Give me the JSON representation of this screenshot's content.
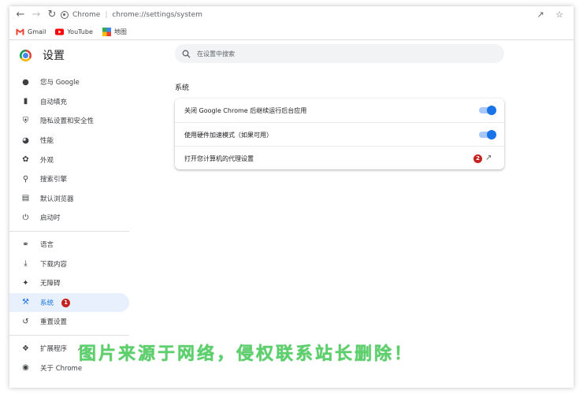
{
  "toolbar": {
    "back_icon": "arrow-left-icon",
    "forward_icon": "arrow-right-icon",
    "reload_icon": "reload-icon",
    "site_name": "Chrome",
    "url": "chrome://settings/system",
    "share_icon": "share-icon",
    "bookmark_icon": "star-icon"
  },
  "bookmarks": [
    {
      "label": "Gmail",
      "icon": "gmail-icon"
    },
    {
      "label": "YouTube",
      "icon": "youtube-icon"
    },
    {
      "label": "地图",
      "icon": "maps-icon"
    }
  ],
  "sidebar": {
    "title": "设置",
    "items_group1": [
      {
        "label": "您与 Google",
        "icon": "person-icon"
      },
      {
        "label": "自动填充",
        "icon": "clipboard-icon"
      },
      {
        "label": "隐私设置和安全性",
        "icon": "shield-icon"
      },
      {
        "label": "性能",
        "icon": "speedometer-icon"
      },
      {
        "label": "外观",
        "icon": "palette-icon"
      },
      {
        "label": "搜索引擎",
        "icon": "search-icon"
      },
      {
        "label": "默认浏览器",
        "icon": "browser-icon"
      },
      {
        "label": "启动时",
        "icon": "power-icon"
      }
    ],
    "items_group2": [
      {
        "label": "语言",
        "icon": "globe-icon"
      },
      {
        "label": "下载内容",
        "icon": "download-icon"
      },
      {
        "label": "无障碍",
        "icon": "accessibility-icon"
      },
      {
        "label": "系统",
        "icon": "wrench-icon",
        "active": true,
        "badge": "1"
      },
      {
        "label": "重置设置",
        "icon": "restore-icon"
      }
    ],
    "items_group3": [
      {
        "label": "扩展程序",
        "icon": "puzzle-icon"
      },
      {
        "label": "关于 Chrome",
        "icon": "chrome-icon"
      }
    ]
  },
  "search": {
    "placeholder": "在设置中搜索"
  },
  "main": {
    "section_title": "系统",
    "rows": [
      {
        "label": "关闭 Google Chrome 后继续运行后台应用",
        "control": "toggle",
        "on": true
      },
      {
        "label": "使用硬件加速模式（如果可用）",
        "control": "toggle",
        "on": true
      },
      {
        "label": "打开您计算机的代理设置",
        "control": "external-link",
        "badge": "2"
      }
    ]
  },
  "watermark": "图片来源于网络，侵权联系站长删除！",
  "colors": {
    "accent": "#1a73e8",
    "badge": "#c5221f",
    "active_bg": "#e8f0fe"
  }
}
